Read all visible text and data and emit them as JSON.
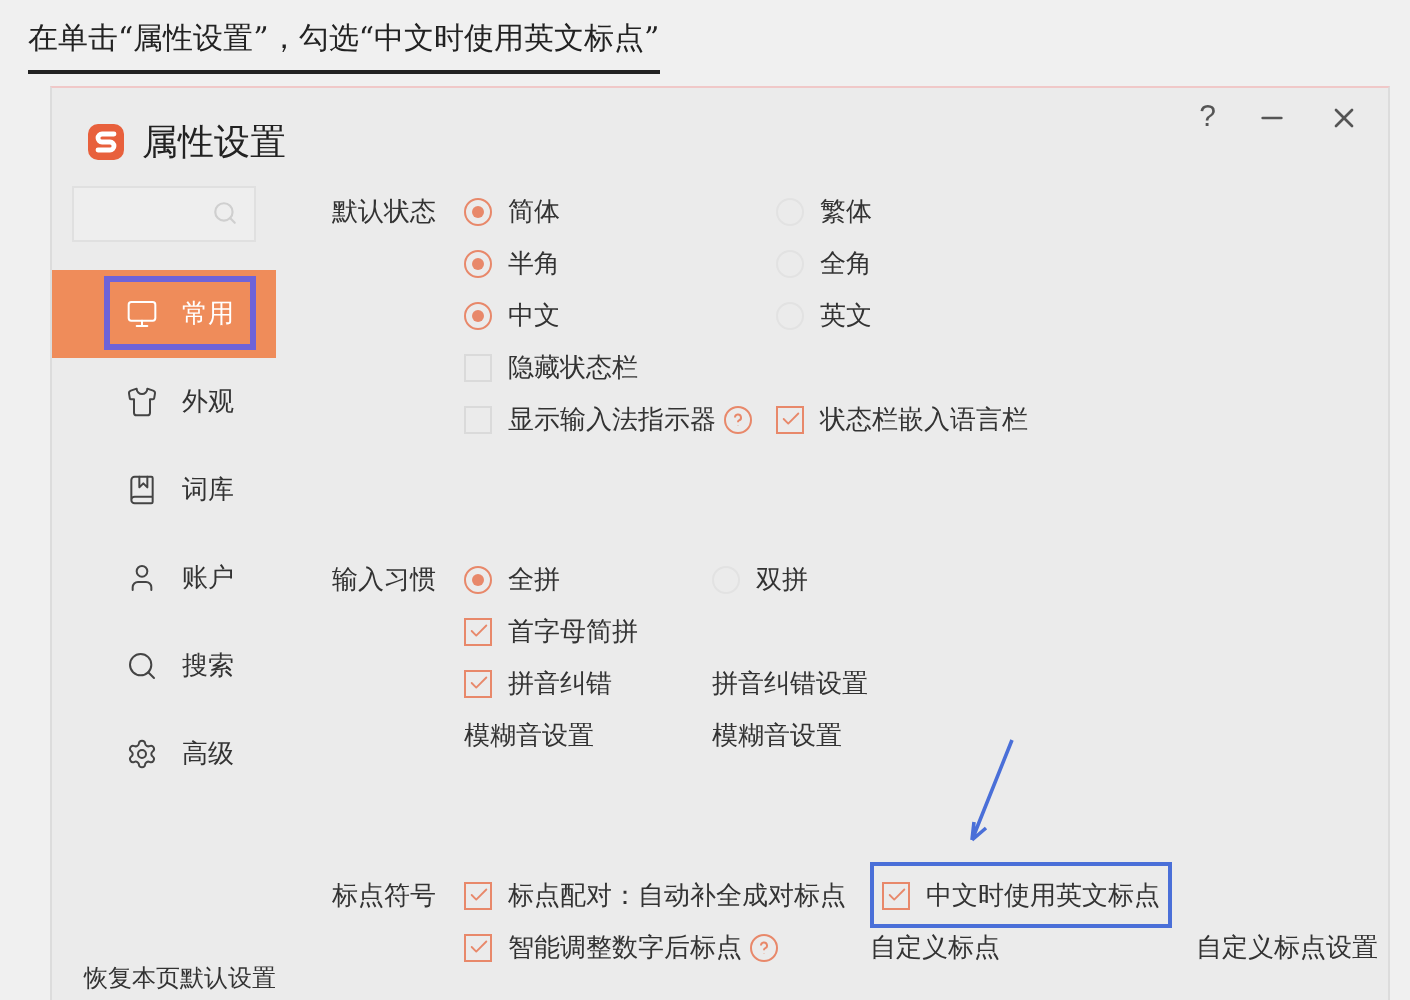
{
  "caption": "在单击“属性设置”，勾选“中文时使用英文标点”",
  "window": {
    "title": "属性设置",
    "help_button": "?"
  },
  "sidebar": {
    "items": [
      {
        "label": "常用",
        "selected": true,
        "highlighted": true
      },
      {
        "label": "外观",
        "selected": false,
        "highlighted": false
      },
      {
        "label": "词库",
        "selected": false,
        "highlighted": false
      },
      {
        "label": "账户",
        "selected": false,
        "highlighted": false
      },
      {
        "label": "搜索",
        "selected": false,
        "highlighted": false
      },
      {
        "label": "高级",
        "selected": false,
        "highlighted": false
      }
    ],
    "footer": "恢复本页默认设置"
  },
  "sections": [
    {
      "label": "默认状态",
      "rows": [
        [
          {
            "kind": "radio",
            "label": "简体",
            "selected": true
          },
          {
            "kind": "radio",
            "label": "繁体",
            "selected": false
          }
        ],
        [
          {
            "kind": "radio",
            "label": "半角",
            "selected": true
          },
          {
            "kind": "radio",
            "label": "全角",
            "selected": false
          }
        ],
        [
          {
            "kind": "radio",
            "label": "中文",
            "selected": true
          },
          {
            "kind": "radio",
            "label": "英文",
            "selected": false
          }
        ],
        [
          {
            "kind": "checkbox",
            "label": "隐藏状态栏",
            "checked": false
          }
        ],
        [
          {
            "kind": "checkbox",
            "label": "显示输入法指示器",
            "checked": false,
            "help": true
          },
          {
            "kind": "checkbox",
            "label": "状态栏嵌入语言栏",
            "checked": true
          }
        ]
      ]
    },
    {
      "label": "输入习惯",
      "rows": [
        [
          {
            "kind": "radio",
            "label": "全拼",
            "selected": true
          },
          {
            "kind": "radio",
            "label": "双拼",
            "selected": false
          }
        ],
        [
          {
            "kind": "checkbox",
            "label": "首字母简拼",
            "checked": true
          }
        ],
        [
          {
            "kind": "checkbox",
            "label": "拼音纠错",
            "checked": true
          },
          {
            "kind": "link",
            "label": "拼音纠错设置"
          }
        ],
        [
          {
            "kind": "link",
            "label": "模糊音设置"
          },
          {
            "kind": "link",
            "label": "模糊音设置"
          }
        ]
      ]
    },
    {
      "label": "标点符号",
      "rows": [
        [
          {
            "kind": "checkbox",
            "label": "标点配对：自动补全成对标点",
            "checked": true
          },
          {
            "kind": "checkbox",
            "label": "中文时使用英文标点",
            "checked": true,
            "highlighted": true
          }
        ],
        [
          {
            "kind": "checkbox",
            "label": "智能调整数字后标点",
            "checked": true,
            "help": true
          },
          {
            "kind": "link",
            "label": "自定义标点"
          },
          {
            "kind": "link",
            "label": "自定义标点设置"
          }
        ]
      ]
    }
  ]
}
